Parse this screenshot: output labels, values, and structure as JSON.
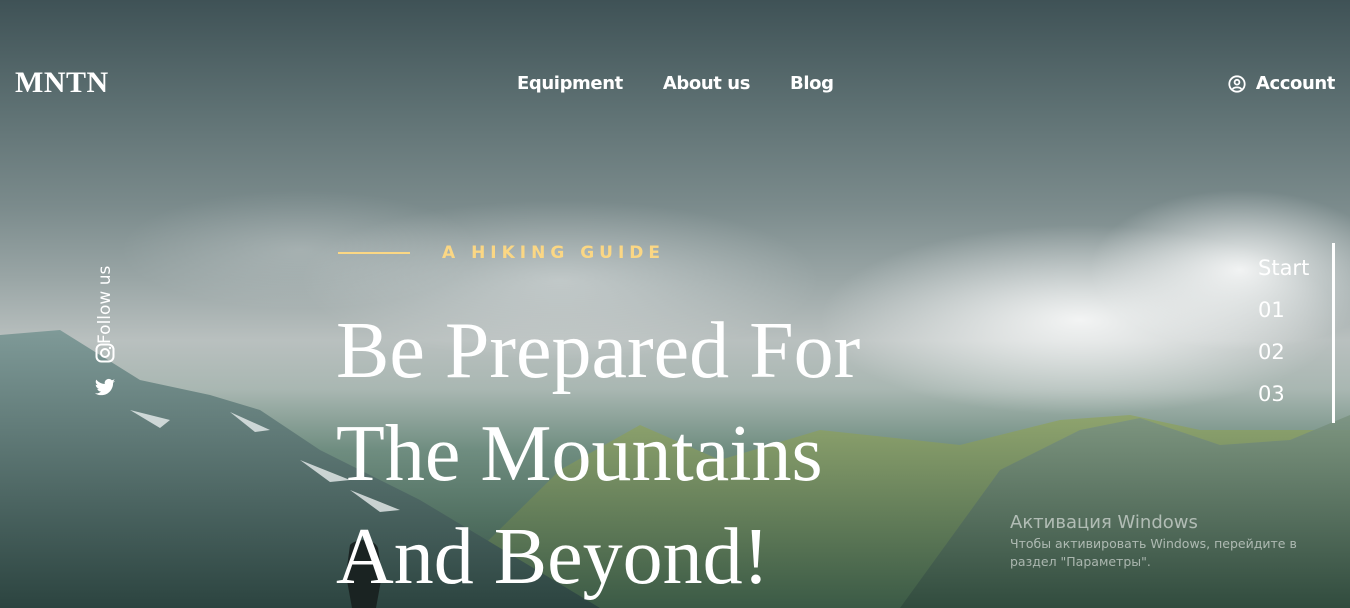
{
  "brand": {
    "logo": "MNTN"
  },
  "nav": {
    "items": [
      "Equipment",
      "About us",
      "Blog"
    ]
  },
  "account": {
    "label": "Account",
    "icon": "user-circle-icon"
  },
  "social": {
    "label": "Follow us",
    "icons": [
      "instagram-icon",
      "twitter-icon"
    ]
  },
  "hero": {
    "kicker": "A HIKING GUIDE",
    "title_lines": [
      "Be Prepared For",
      "The Mountains",
      "And Beyond!"
    ]
  },
  "pager": {
    "items": [
      "Start",
      "01",
      "02",
      "03"
    ]
  },
  "watermark": {
    "title": "Активация Windows",
    "text": "Чтобы активировать Windows, перейдите в раздел \"Параметры\"."
  },
  "colors": {
    "accent": "#fbd784",
    "text": "#ffffff"
  }
}
